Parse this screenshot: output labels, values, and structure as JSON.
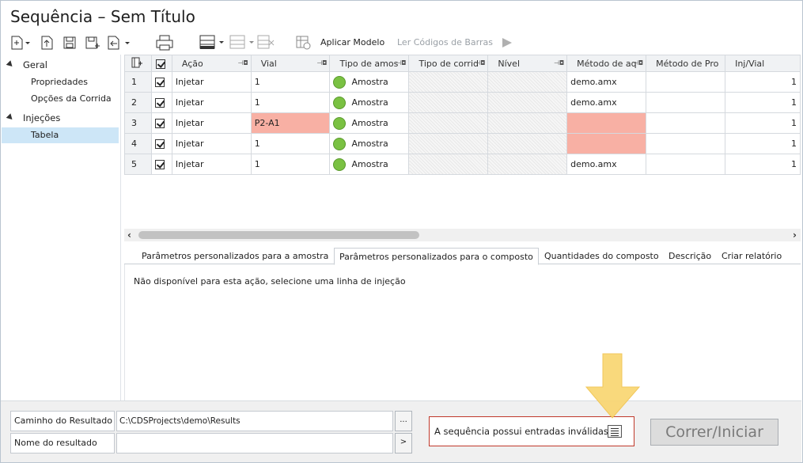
{
  "window": {
    "title": "Sequência – Sem Título"
  },
  "toolbar": {
    "apply_template": "Aplicar Modelo",
    "read_barcodes": "Ler Códigos de Barras"
  },
  "sidebar": {
    "groups": [
      {
        "label": "Geral",
        "items": [
          "Propriedades",
          "Opções da Corrida"
        ]
      },
      {
        "label": "Injeções",
        "items": [
          "Tabela"
        ]
      }
    ],
    "selected": "Tabela"
  },
  "grid": {
    "columns": [
      "Ação",
      "Vial",
      "Tipo de amos",
      "Tipo de corrid",
      "Nível",
      "Método de aq",
      "Método de Pro",
      "Inj/Vial"
    ],
    "rows": [
      {
        "n": "1",
        "action": "Injetar",
        "vial": "1",
        "type": "Amostra",
        "method": "demo.amx",
        "inj": "1"
      },
      {
        "n": "2",
        "action": "Injetar",
        "vial": "1",
        "type": "Amostra",
        "method": "demo.amx",
        "inj": "1"
      },
      {
        "n": "3",
        "action": "Injetar",
        "vial": "P2-A1",
        "type": "Amostra",
        "method": "",
        "inj": "1"
      },
      {
        "n": "4",
        "action": "Injetar",
        "vial": "1",
        "type": "Amostra",
        "method": "",
        "inj": "1"
      },
      {
        "n": "5",
        "action": "Injetar",
        "vial": "1",
        "type": "Amostra",
        "method": "demo.amx",
        "inj": "1"
      }
    ]
  },
  "tabs": [
    "Parâmetros personalizados para a amostra",
    "Parâmetros personalizados para o composto",
    "Quantidades do composto",
    "Descrição",
    "Criar relatório"
  ],
  "detail": {
    "message": "Não disponível para esta ação, selecione uma linha de injeção"
  },
  "bottom": {
    "result_path_label": "Caminho do Resultado",
    "result_path_value": "C:\\CDSProjects\\demo\\Results",
    "browse_button": "...",
    "result_name_label": "Nome do resultado",
    "result_name_value": "",
    "name_button": ">",
    "warning": "A sequência possui entradas inválidas",
    "run_button": "Correr/Iniciar"
  },
  "colors": {
    "invalid_cell": "#f8b0a4",
    "selected_tree": "#cde6f7",
    "status_green": "#7ac142",
    "annotation_arrow": "#f9d56e"
  }
}
